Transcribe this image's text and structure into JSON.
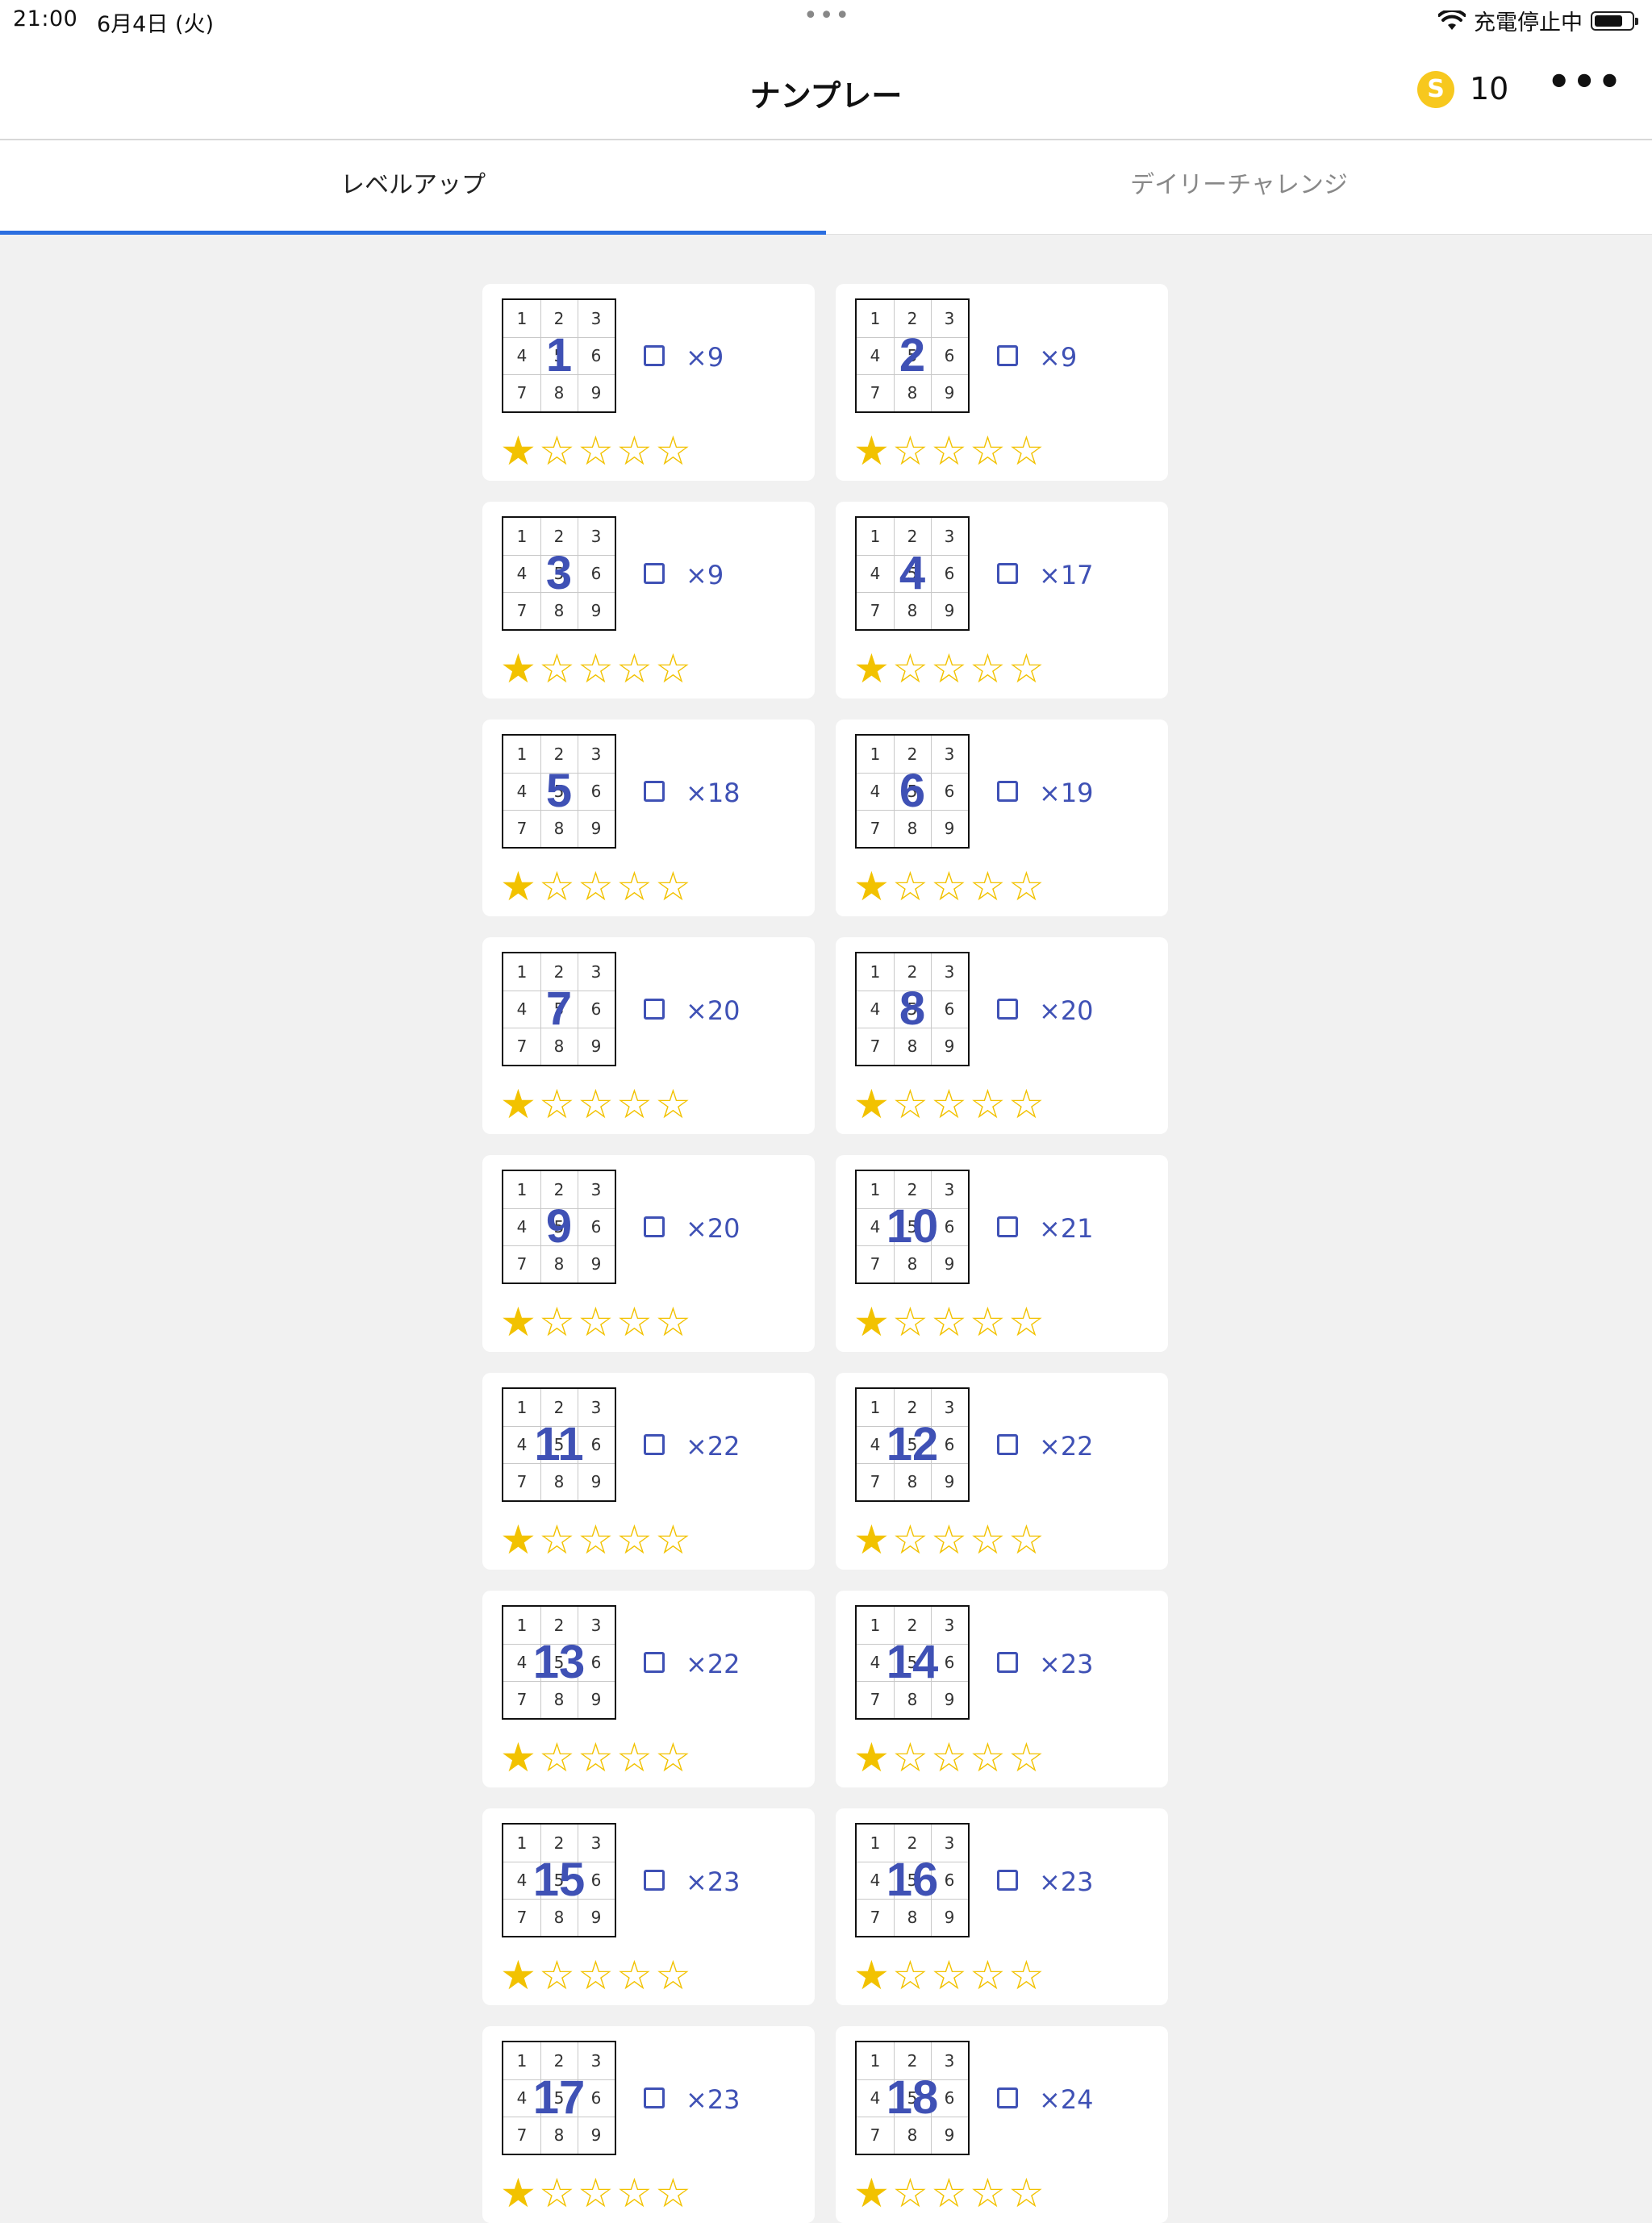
{
  "status_bar": {
    "time": "21:00",
    "date": "6月4日 (火)",
    "charging_label": "充電停止中"
  },
  "header": {
    "title": "ナンプレー",
    "coin_letter": "S",
    "coin_count": "10",
    "more_label": "•••"
  },
  "tabs": [
    {
      "label": "レベルアップ",
      "active": true
    },
    {
      "label": "デイリーチャレンジ",
      "active": false
    }
  ],
  "colors": {
    "accent": "#3f51b5",
    "tab_indicator": "#2c6fe0",
    "star": "#f2c200",
    "coin": "#f7c81e"
  },
  "grid_digits": [
    "1",
    "2",
    "3",
    "4",
    "5",
    "6",
    "7",
    "8",
    "9"
  ],
  "levels": [
    {
      "level": "1",
      "count": "×9",
      "stars": 1,
      "max_stars": 5
    },
    {
      "level": "2",
      "count": "×9",
      "stars": 1,
      "max_stars": 5
    },
    {
      "level": "3",
      "count": "×9",
      "stars": 1,
      "max_stars": 5
    },
    {
      "level": "4",
      "count": "×17",
      "stars": 1,
      "max_stars": 5
    },
    {
      "level": "5",
      "count": "×18",
      "stars": 1,
      "max_stars": 5
    },
    {
      "level": "6",
      "count": "×19",
      "stars": 1,
      "max_stars": 5
    },
    {
      "level": "7",
      "count": "×20",
      "stars": 1,
      "max_stars": 5
    },
    {
      "level": "8",
      "count": "×20",
      "stars": 1,
      "max_stars": 5
    },
    {
      "level": "9",
      "count": "×20",
      "stars": 1,
      "max_stars": 5
    },
    {
      "level": "10",
      "count": "×21",
      "stars": 1,
      "max_stars": 5
    },
    {
      "level": "11",
      "count": "×22",
      "stars": 1,
      "max_stars": 5
    },
    {
      "level": "12",
      "count": "×22",
      "stars": 1,
      "max_stars": 5
    },
    {
      "level": "13",
      "count": "×22",
      "stars": 1,
      "max_stars": 5
    },
    {
      "level": "14",
      "count": "×23",
      "stars": 1,
      "max_stars": 5
    },
    {
      "level": "15",
      "count": "×23",
      "stars": 1,
      "max_stars": 5
    },
    {
      "level": "16",
      "count": "×23",
      "stars": 1,
      "max_stars": 5
    },
    {
      "level": "17",
      "count": "×23",
      "stars": 1,
      "max_stars": 5
    },
    {
      "level": "18",
      "count": "×24",
      "stars": 1,
      "max_stars": 5
    }
  ]
}
